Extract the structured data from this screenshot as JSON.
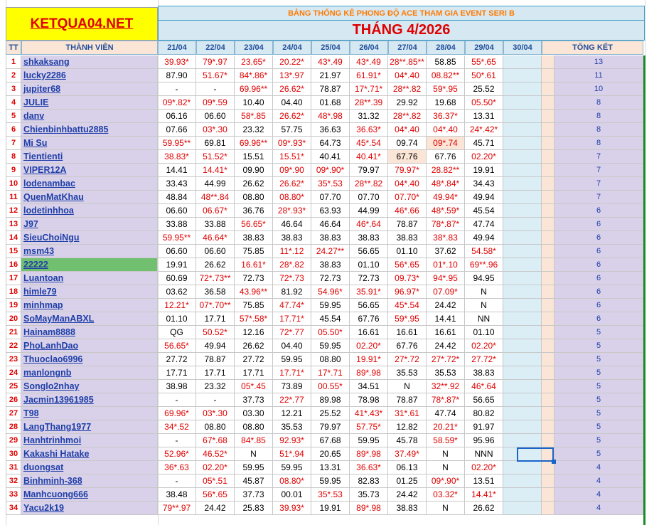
{
  "logo": "KETQUA04.NET",
  "banner_subtitle": "BẢNG THỐNG KÊ PHONG ĐỘ ACE THAM GIA EVENT SERI B",
  "banner_title": "THÁNG 4/2026",
  "headers": {
    "tt": "TT",
    "member": "THÀNH VIÊN",
    "dates": [
      "21/04",
      "22/04",
      "23/04",
      "24/04",
      "25/04",
      "26/04",
      "27/04",
      "28/04",
      "29/04",
      "30/04"
    ],
    "total": "TỔNG KẾT"
  },
  "colors": {
    "logo_bg": "#ffff00",
    "logo_text": "#e00000",
    "banner_bg": "#d6e8f2",
    "subtitle_text": "#ff7a00",
    "title_text": "#e00000",
    "name_bg": "#d9d1e9",
    "name_text": "#1f3fa8",
    "highlight_row": "#70c070",
    "red_value": "#e00000"
  },
  "rows": [
    {
      "tt": "1",
      "name": "shkaksang",
      "values": [
        "39.93*",
        "79*.97",
        "23.65*",
        "20.22*",
        "43*.49",
        "43*.49",
        "28**.85**",
        "58.85",
        "55*.65",
        ""
      ],
      "total": "13"
    },
    {
      "tt": "2",
      "name": "lucky2286",
      "values": [
        "87.90",
        "51.67*",
        "84*.86*",
        "13*.97",
        "21.97",
        "61.91*",
        "04*.40",
        "08.82**",
        "50*.61",
        ""
      ],
      "total": "11"
    },
    {
      "tt": "3",
      "name": "jupiter68",
      "values": [
        "-",
        "-",
        "69.96**",
        "26.62*",
        "78.87",
        "17*.71*",
        "28**.82",
        "59*.95",
        "25.52",
        ""
      ],
      "total": "10"
    },
    {
      "tt": "4",
      "name": "JULIE",
      "values": [
        "09*.82*",
        "09*.59",
        "10.40",
        "04.40",
        "01.68",
        "28**.39",
        "29.92",
        "19.68",
        "05.50*",
        ""
      ],
      "total": "8"
    },
    {
      "tt": "5",
      "name": "danv",
      "values": [
        "06.16",
        "06.60",
        "58*.85",
        "26.62*",
        "48*.98",
        "31.32",
        "28**.82",
        "36.37*",
        "13.31",
        ""
      ],
      "total": "8"
    },
    {
      "tt": "6",
      "name": "Chienbinhbattu2885",
      "values": [
        "07.66",
        "03*.30",
        "23.32",
        "57.75",
        "36.63",
        "36.63*",
        "04*.40",
        "04*.40",
        "24*.42*",
        ""
      ],
      "total": "8"
    },
    {
      "tt": "7",
      "name": "Mi Su",
      "values": [
        "59.95**",
        "69.81",
        "69.96**",
        "09*.93*",
        "64.73",
        "45*.54",
        "09.74",
        "09*.74",
        "45.71",
        ""
      ],
      "total": "8"
    },
    {
      "tt": "8",
      "name": "Tientienti",
      "values": [
        "38.83*",
        "51.52*",
        "15.51",
        "15.51*",
        "40.41",
        "40.41*",
        "67.76",
        "67.76",
        "02.20*",
        ""
      ],
      "total": "7"
    },
    {
      "tt": "9",
      "name": "VIPER12A",
      "values": [
        "14.41",
        "14.41*",
        "09.90",
        "09*.90",
        "09*.90*",
        "79.97",
        "79.97*",
        "28.82**",
        "19.91",
        ""
      ],
      "total": "7"
    },
    {
      "tt": "10",
      "name": "lodenambac",
      "values": [
        "33.43",
        "44.99",
        "26.62",
        "26.62*",
        "35*.53",
        "28**.82",
        "04*.40",
        "48*.84*",
        "34.43",
        ""
      ],
      "total": "7"
    },
    {
      "tt": "11",
      "name": "QuenMatKhau",
      "values": [
        "48.84",
        "48**.84",
        "08.80",
        "08.80*",
        "07.70",
        "07.70",
        "07.70*",
        "49.94*",
        "49.94",
        ""
      ],
      "total": "7"
    },
    {
      "tt": "12",
      "name": "lodetinhhoa",
      "values": [
        "06.60",
        "06.67*",
        "36.76",
        "28*.93*",
        "63.93",
        "44.99",
        "46*.66",
        "48*.59*",
        "45.54",
        ""
      ],
      "total": "6"
    },
    {
      "tt": "13",
      "name": "J97",
      "values": [
        "33.88",
        "33.88",
        "56.65*",
        "46.64",
        "46.64",
        "46*.64",
        "78.87",
        "78*.87*",
        "47.74",
        ""
      ],
      "total": "6"
    },
    {
      "tt": "14",
      "name": "SieuChoiNgu",
      "values": [
        "59.95**",
        "46.64*",
        "38.83",
        "38.83",
        "38.83",
        "38.83",
        "38.83",
        "38*.83",
        "49.94",
        ""
      ],
      "total": "6"
    },
    {
      "tt": "15",
      "name": "msm43",
      "values": [
        "06.60",
        "06.60",
        "75.85",
        "11*.12",
        "24.27**",
        "56.65",
        "01.10",
        "37.62",
        "54.58*",
        ""
      ],
      "total": "6"
    },
    {
      "tt": "16",
      "name": "22222",
      "values": [
        "19.91",
        "26.62",
        "16.61*",
        "28*.82",
        "38.83",
        "01.10",
        "56*.65",
        "01*.10",
        "69**.96",
        ""
      ],
      "total": "6"
    },
    {
      "tt": "17",
      "name": "Luantoan",
      "values": [
        "60.69",
        "72*.73**",
        "72.73",
        "72*.73",
        "72.73",
        "72.73",
        "09.73*",
        "94*.95",
        "94.95",
        ""
      ],
      "total": "6"
    },
    {
      "tt": "18",
      "name": "himle79",
      "values": [
        "03.62",
        "36.58",
        "43.96**",
        "81.92",
        "54.96*",
        "35.91*",
        "96.97*",
        "07.09*",
        "N",
        ""
      ],
      "total": "6"
    },
    {
      "tt": "19",
      "name": "minhmap",
      "values": [
        "12.21*",
        "07*.70**",
        "75.85",
        "47.74*",
        "59.95",
        "56.65",
        "45*.54",
        "24.42",
        "N",
        ""
      ],
      "total": "6"
    },
    {
      "tt": "20",
      "name": "SoMayManABXL",
      "values": [
        "01.10",
        "17.71",
        "57*.58*",
        "17.71*",
        "45.54",
        "67.76",
        "59*.95",
        "14.41",
        "NN",
        ""
      ],
      "total": "6"
    },
    {
      "tt": "21",
      "name": "Hainam8888",
      "values": [
        "QG",
        "50.52*",
        "12.16",
        "72*.77",
        "05.50*",
        "16.61",
        "16.61",
        "16.61",
        "01.10",
        ""
      ],
      "total": "5"
    },
    {
      "tt": "22",
      "name": "PhoLanhDao",
      "values": [
        "56.65*",
        "49.94",
        "26.62",
        "04.40",
        "59.95",
        "02.20*",
        "67.76",
        "24.42",
        "02.20*",
        ""
      ],
      "total": "5"
    },
    {
      "tt": "23",
      "name": "Thuoclao6996",
      "values": [
        "27.72",
        "78.87",
        "27.72",
        "59.95",
        "08.80",
        "19.91*",
        "27*.72",
        "27*.72*",
        "27.72*",
        ""
      ],
      "total": "5"
    },
    {
      "tt": "24",
      "name": "manlongnb",
      "values": [
        "17.71",
        "17.71",
        "17.71",
        "17.71*",
        "17*.71",
        "89*.98",
        "35.53",
        "35.53",
        "38.83",
        ""
      ],
      "total": "5"
    },
    {
      "tt": "25",
      "name": "Songlo2nhay",
      "values": [
        "38.98",
        "23.32",
        "05*.45",
        "73.89",
        "00.55*",
        "34.51",
        "N",
        "32**.92",
        "46*.64",
        ""
      ],
      "total": "5"
    },
    {
      "tt": "26",
      "name": "Jacmin13961985",
      "values": [
        "-",
        "-",
        "37.73",
        "22*.77",
        "89.98",
        "78.98",
        "78.87",
        "78*.87*",
        "56.65",
        ""
      ],
      "total": "5"
    },
    {
      "tt": "27",
      "name": "T98",
      "values": [
        "69.96*",
        "03*.30",
        "03.30",
        "12.21",
        "25.52",
        "41*.43*",
        "31*.61",
        "47.74",
        "80.82",
        ""
      ],
      "total": "5"
    },
    {
      "tt": "28",
      "name": "LangThang1977",
      "values": [
        "34*.52",
        "08.80",
        "08.80",
        "35.53",
        "79.97",
        "57.75*",
        "12.82",
        "20.21*",
        "91.97",
        ""
      ],
      "total": "5"
    },
    {
      "tt": "29",
      "name": "Hanhtrinhmoi",
      "values": [
        "-",
        "67*.68",
        "84*.85",
        "92.93*",
        "67.68",
        "59.95",
        "45.78",
        "58.59*",
        "95.96",
        ""
      ],
      "total": "5"
    },
    {
      "tt": "30",
      "name": "Kakashi Hatake",
      "values": [
        "52.96*",
        "46.52*",
        "N",
        "51*.94",
        "20.65",
        "89*.98",
        "37.49*",
        "N",
        "NNN",
        ""
      ],
      "total": "5"
    },
    {
      "tt": "31",
      "name": "duongsat",
      "values": [
        "36*.63",
        "02.20*",
        "59.95",
        "59.95",
        "13.31",
        "36.63*",
        "06.13",
        "N",
        "02.20*",
        ""
      ],
      "total": "4"
    },
    {
      "tt": "32",
      "name": "Binhminh-368",
      "values": [
        "-",
        "05*.51",
        "45.87",
        "08.80*",
        "59.95",
        "82.83",
        "01.25",
        "09*.90*",
        "13.51",
        ""
      ],
      "total": "4"
    },
    {
      "tt": "33",
      "name": "Manhcuong666",
      "values": [
        "38.48",
        "56*.65",
        "37.73",
        "00.01",
        "35*.53",
        "35.73",
        "24.42",
        "03.32*",
        "14.41*",
        ""
      ],
      "total": "4"
    },
    {
      "tt": "34",
      "name": "Yacu2k19",
      "values": [
        "79**.97",
        "24.42",
        "25.83",
        "39.93*",
        "19.91",
        "89*.98",
        "38.83",
        "N",
        "26.62",
        ""
      ],
      "total": "4"
    }
  ]
}
